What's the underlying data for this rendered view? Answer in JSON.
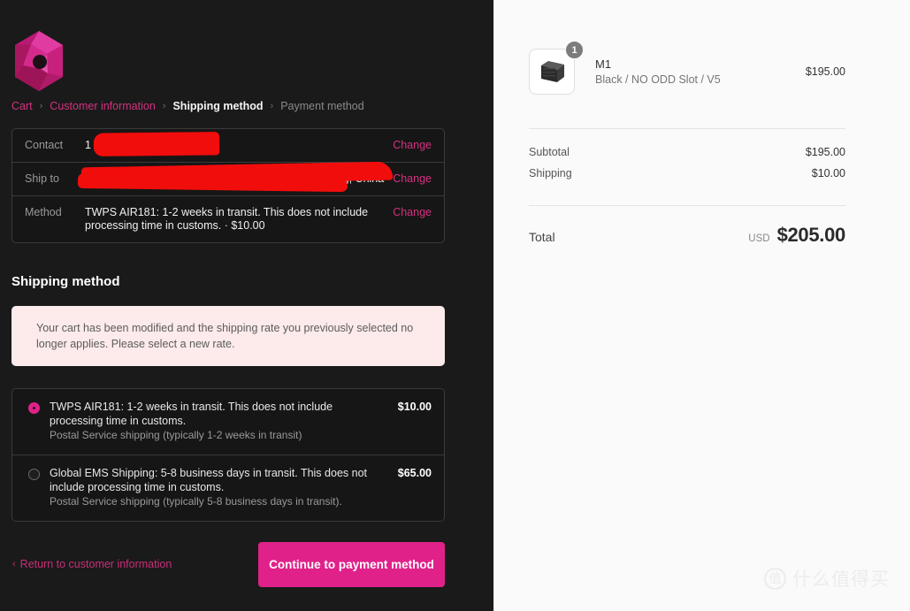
{
  "brand": {
    "logo_name": "faceted-hexagon-gem-logo",
    "accent_color": "#e0218a",
    "link_color": "#d4317f"
  },
  "breadcrumb": {
    "items": [
      {
        "label": "Cart",
        "state": "link"
      },
      {
        "label": "Customer information",
        "state": "link"
      },
      {
        "label": "Shipping method",
        "state": "active"
      },
      {
        "label": "Payment method",
        "state": "muted"
      }
    ],
    "separator": "›"
  },
  "review": {
    "rows": [
      {
        "label": "Contact",
        "value": "1",
        "redacted": true,
        "change_label": "Change"
      },
      {
        "label": "Ship to",
        "value": "0 Guangdong, China",
        "redacted": true,
        "change_label": "Change"
      },
      {
        "label": "Method",
        "value": "TWPS AIR181: 1-2 weeks in transit. This does not include processing time in customs. · $10.00",
        "redacted": false,
        "change_label": "Change"
      }
    ]
  },
  "shipping_section": {
    "title": "Shipping method",
    "notice": "Your cart has been modified and the shipping rate you previously selected no longer applies. Please select a new rate.",
    "notice_bg": "#fdeaea",
    "options": [
      {
        "selected": true,
        "title": "TWPS AIR181: 1-2 weeks in transit. This does not include processing time in customs.",
        "subtitle": "Postal Service shipping (typically 1-2 weeks in transit)",
        "price": "$10.00"
      },
      {
        "selected": false,
        "title": "Global EMS Shipping: 5-8 business days in transit. This does not include processing time in customs.",
        "subtitle": "Postal Service shipping (typically 5-8 business days in transit).",
        "price": "$65.00"
      }
    ]
  },
  "actions": {
    "return_chevron": "‹",
    "return_label": "Return to customer information",
    "continue_label": "Continue to payment method"
  },
  "summary": {
    "item": {
      "thumbnail_name": "product-thumbnail-black-case",
      "quantity": "1",
      "title": "M1",
      "variant": "Black / NO ODD Slot / V5",
      "price": "$195.00"
    },
    "lines": [
      {
        "label": "Subtotal",
        "value": "$195.00"
      },
      {
        "label": "Shipping",
        "value": "$10.00"
      }
    ],
    "total": {
      "label": "Total",
      "currency": "USD",
      "value": "$205.00"
    }
  },
  "watermark": {
    "mark": "值",
    "text": "什么值得买"
  }
}
